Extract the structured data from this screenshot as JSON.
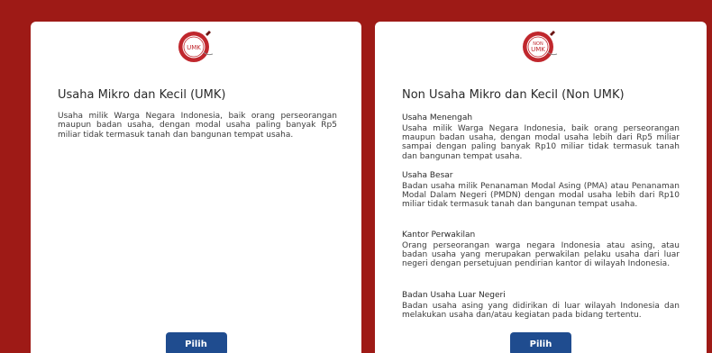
{
  "colors": {
    "background": "#9e1a16",
    "card": "#ffffff",
    "button": "#1f4c8f",
    "seal": "#c0272d"
  },
  "umk_card": {
    "badge_icon": "umk-seal-icon",
    "badge_text": "UMK",
    "title": "Usaha Mikro dan Kecil (UMK)",
    "description": "Usaha milik Warga Negara Indonesia, baik orang perseorangan maupun badan usaha, dengan modal usaha paling banyak Rp5 miliar tidak termasuk tanah dan bangunan tempat usaha.",
    "button_label": "Pilih"
  },
  "non_umk_card": {
    "badge_icon": "non-umk-seal-icon",
    "badge_text_top": "NON",
    "badge_text": "UMK",
    "title": "Non Usaha Mikro dan Kecil (Non UMK)",
    "sections": [
      {
        "heading": "Usaha Menengah",
        "text": "Usaha milik Warga Negara Indonesia, baik orang perseorangan maupun badan usaha, dengan modal usaha lebih dari Rp5 miliar sampai dengan paling banyak Rp10 miliar tidak termasuk tanah dan bangunan tempat usaha."
      },
      {
        "heading": "Usaha Besar",
        "text": "Badan usaha milik Penanaman Modal Asing (PMA) atau Penanaman Modal Dalam Negeri (PMDN) dengan modal usaha lebih dari Rp10 miliar tidak termasuk tanah dan bangunan tempat usaha."
      },
      {
        "heading": "Kantor Perwakilan",
        "text": "Orang perseorangan warga negara Indonesia atau asing, atau badan usaha yang merupakan perwakilan pelaku usaha dari luar negeri dengan persetujuan pendirian kantor di wilayah Indonesia."
      },
      {
        "heading": "Badan Usaha Luar Negeri",
        "text": "Badan usaha asing yang didirikan di luar wilayah Indonesia dan melakukan usaha dan/atau kegiatan pada bidang tertentu."
      }
    ],
    "button_label": "Pilih"
  }
}
